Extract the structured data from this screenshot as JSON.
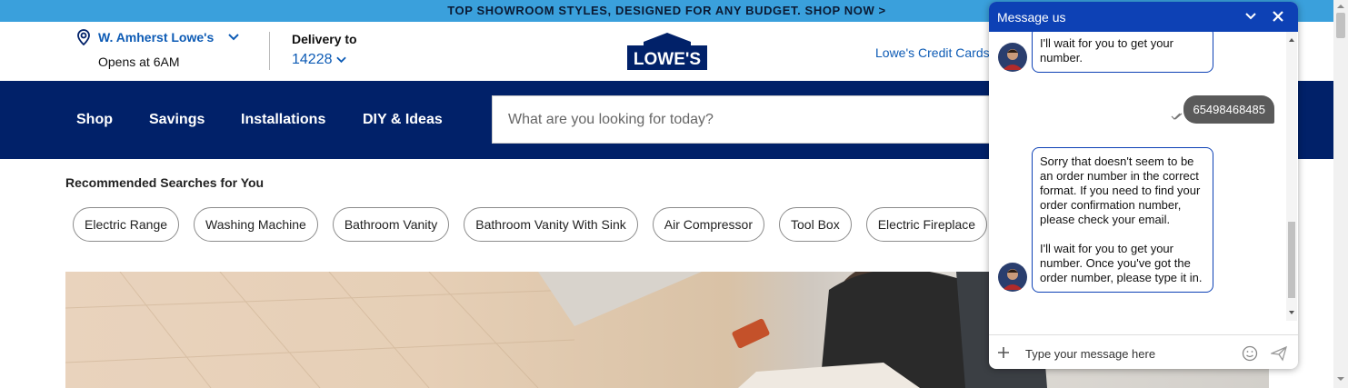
{
  "promo": {
    "text": "TOP SHOWROOM STYLES, DESIGNED FOR ANY BUDGET. SHOP NOW >"
  },
  "store": {
    "name": "W. Amherst Lowe's",
    "hours": "Opens at 6AM"
  },
  "delivery": {
    "label": "Delivery to",
    "zip": "14228"
  },
  "logo": {
    "text": "LOWE'S"
  },
  "header": {
    "credit_link": "Lowe's Credit Cards"
  },
  "nav": {
    "items": [
      "Shop",
      "Savings",
      "Installations",
      "DIY & Ideas"
    ]
  },
  "search": {
    "placeholder": "What are you looking for today?"
  },
  "recommended": {
    "title": "Recommended Searches for You",
    "chips": [
      "Electric Range",
      "Washing Machine",
      "Bathroom Vanity",
      "Bathroom Vanity With Sink",
      "Air Compressor",
      "Tool Box",
      "Electric Fireplace"
    ]
  },
  "chat": {
    "title": "Message us",
    "messages": [
      {
        "from": "agent",
        "text": "I'll wait for you to get your number."
      },
      {
        "from": "user",
        "text": "65498468485"
      },
      {
        "from": "agent",
        "text": "Sorry that doesn't seem to be an order number in the correct format. If you need to find your order confirmation number, please check your email."
      },
      {
        "from": "agent",
        "text": "I'll wait for you to get your number. Once you've got the order number, please type it in."
      }
    ],
    "input_placeholder": "Type your message here"
  },
  "colors": {
    "brand_blue": "#012169",
    "chat_blue": "#0d41b5",
    "promo_bg": "#3aa0dc",
    "link_blue": "#0d5bb5"
  }
}
